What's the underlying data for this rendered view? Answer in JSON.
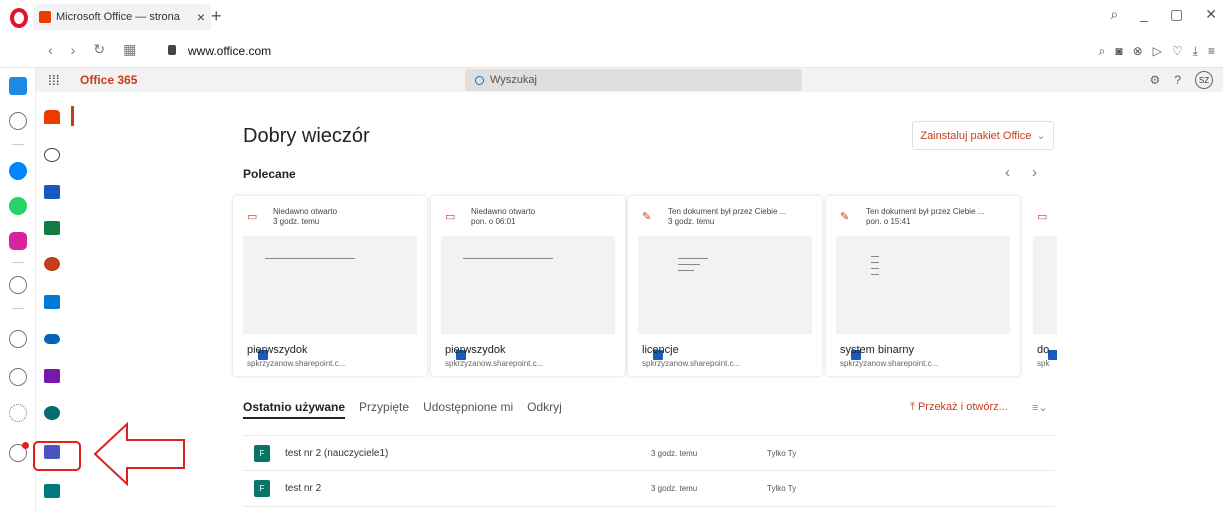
{
  "browser": {
    "tab_title": "Microsoft Office — strona",
    "tab_close": "×",
    "new_tab": "+",
    "url_host": "www.office.com"
  },
  "header": {
    "brand": "Office 365",
    "search_placeholder": "Wyszukaj",
    "avatar_initials": "SZ"
  },
  "main": {
    "greeting": "Dobry wieczór",
    "install_button": "Zainstaluj pakiet Office",
    "recommended_title": "Polecane",
    "cards": [
      {
        "reason": "Niedawno otwarto",
        "when": "3 godz. temu",
        "name": "pierwszydok",
        "site": "spkrzyzanow.sharepoint.c..."
      },
      {
        "reason": "Niedawno otwarto",
        "when": "pon. o 06:01",
        "name": "pierwszydok",
        "site": "spkrzyzanow.sharepoint.c..."
      },
      {
        "reason": "Ten dokument był przez Ciebie ...",
        "when": "3 godz. temu",
        "name": "licencje",
        "site": "spkrzyzanow.sharepoint.c..."
      },
      {
        "reason": "Ten dokument był przez Ciebie ...",
        "when": "pon. o 15:41",
        "name": "system binarny",
        "site": "spkrzyzanow.sharepoint.c..."
      },
      {
        "reason": "",
        "when": "",
        "name": "do",
        "site": "spk"
      }
    ],
    "tabs": [
      "Ostatnio używane",
      "Przypięte",
      "Udostępnione mi",
      "Odkryj"
    ],
    "upload_button": "Przekaż i otwórz...",
    "files": [
      {
        "name": "test nr 2 (nauczyciele1)",
        "time": "3 godz. temu",
        "owner": "Tylko Ty"
      },
      {
        "name": "test nr 2",
        "time": "3 godz. temu",
        "owner": "Tylko Ty"
      }
    ]
  },
  "colors": {
    "office_accent": "#c43e1c",
    "word": "#185abd",
    "forms": "#077568",
    "annotation": "#e02020"
  }
}
